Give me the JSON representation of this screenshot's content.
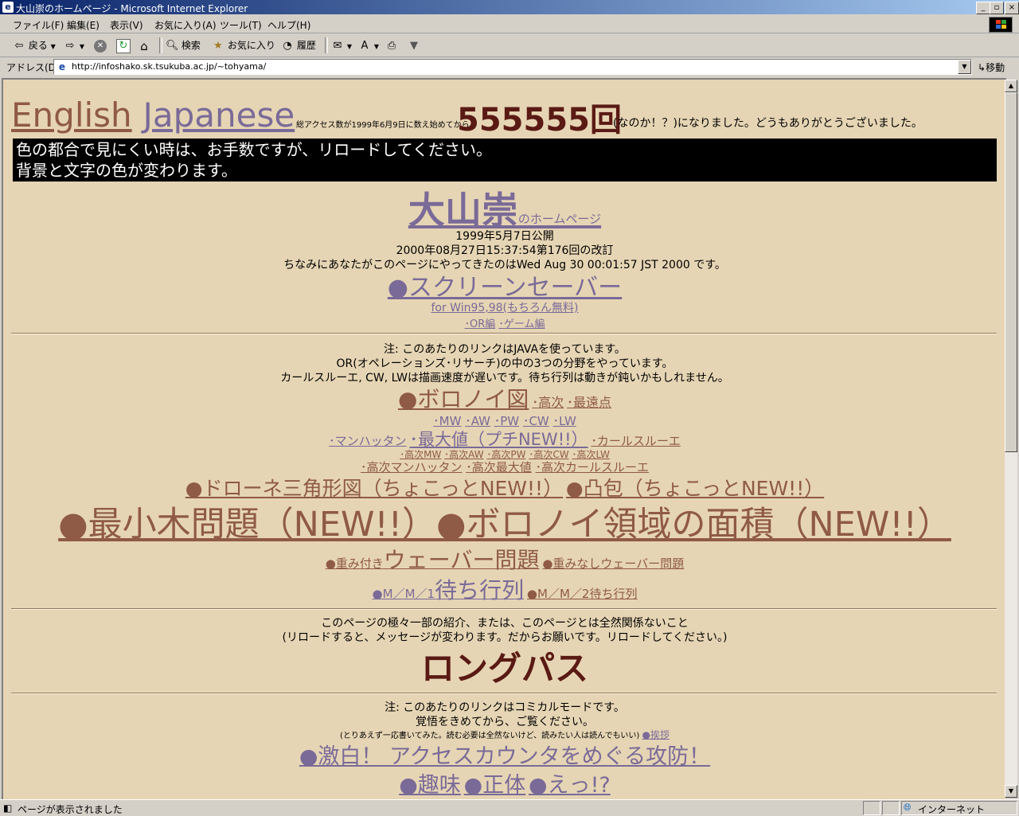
{
  "window": {
    "title": "大山崇のホームページ - Microsoft Internet Explorer",
    "controls": [
      "_",
      "▫",
      "×"
    ]
  },
  "menu": [
    "ファイル(F)",
    "編集(E)",
    "表示(V)",
    "お気に入り(A)",
    "ツール(T)",
    "ヘルプ(H)"
  ],
  "toolbar": {
    "back": "戻る",
    "search": "検索",
    "favorites": "お気に入り",
    "history": "履歴"
  },
  "address": {
    "label": "アドレス(D)",
    "url": "http://infoshako.sk.tsukuba.ac.jp/~tohyama/",
    "go": "移動"
  },
  "status": {
    "text": "ページが表示されました",
    "zone": "インターネット"
  },
  "page": {
    "lang_english": "English",
    "lang_japanese": "Japanese",
    "counter_pre": "総アクセス数が1999年6月9日に数え始めてから",
    "counter_value": "555555回",
    "counter_post": "(なのか！？)になりました。どうもありがとうございました。",
    "notice_line1": "色の都合で見にくい時は、お手数ですが、リロードしてください。",
    "notice_line2": "背景と文字の色が変わります。",
    "name": "大山崇",
    "name_suffix": "のホームページ",
    "published": "1999年5月7日公開",
    "revised": "2000年08月27日15:37:54第176回の改訂",
    "visit_time": "ちなみにあなたがこのページにやってきたのはWed Aug 30 00:01:57 JST 2000 です。",
    "screensaver": "●スクリーンセーバー",
    "screensaver_sub": "for Win95,98(もちろん無料)",
    "ss_or": "･OR編",
    "ss_game": "･ゲーム編",
    "java_note1": "注:  このあたりのリンクはJAVAを使っています。",
    "java_note2": "OR(オペレーションズ･リサーチ)の中の3つの分野をやっています。",
    "java_note3": "カールスルーエ, CW, LWは描画速度が遅いです。待ち行列は動きが鈍いかもしれません。",
    "voronoi": "●ボロノイ図",
    "voronoi_high": "･高次",
    "voronoi_far": "･最遠点",
    "metrics": [
      "･MW",
      "･AW",
      "･PW",
      "･CW",
      "･LW"
    ],
    "manhattan": "･マンハッタン",
    "max_value": "･最大値（プチNEW!!）",
    "karlsruhe": "･カールスルーエ",
    "high_metrics": [
      "･高次MW",
      "･高次AW",
      "･高次PW",
      "･高次CW",
      "･高次LW"
    ],
    "high_manhattan": "･高次マンハッタン",
    "high_max": "･高次最大値",
    "high_karlsruhe": "･高次カールスルーエ",
    "delaunay": "●ドローネ三角形図（ちょこっとNEW!!）",
    "convex": "●凸包（ちょこっとNEW!!）",
    "mst": "●最小木問題（NEW!!）",
    "voronoi_area": "●ボロノイ領域の面積（NEW!!）",
    "weber_weighted_pre": "●重み付き",
    "weber": "ウェーバー問題",
    "weber_unweighted": "●重みなしウェーバー問題",
    "queue_mm1": "●M／M／1",
    "queue": "待ち行列",
    "queue_mm2": "●M／M／2待ち行列",
    "intro1": "このページの極々一部の紹介、または、このページとは全然関係ないこと",
    "intro2": "(リロードすると、メッセージが変わります。だからお願いです。リロードしてください。)",
    "long_path": "ロングパス",
    "comical1": "注:  このあたりのリンクはコミカルモードです。",
    "comical2": "覚悟をきめてから、ご覧ください。",
    "comical3": "(とりあえず一応書いてみた。読む必要は全然ないけど、読みたい人は読んでもいい)",
    "greeting": "●挨拶",
    "counter_battle": "●激白！ アクセスカウンタをめぐる攻防！",
    "hobby": "●趣味",
    "identity": "●正体",
    "eh": "●えっ!?"
  }
}
